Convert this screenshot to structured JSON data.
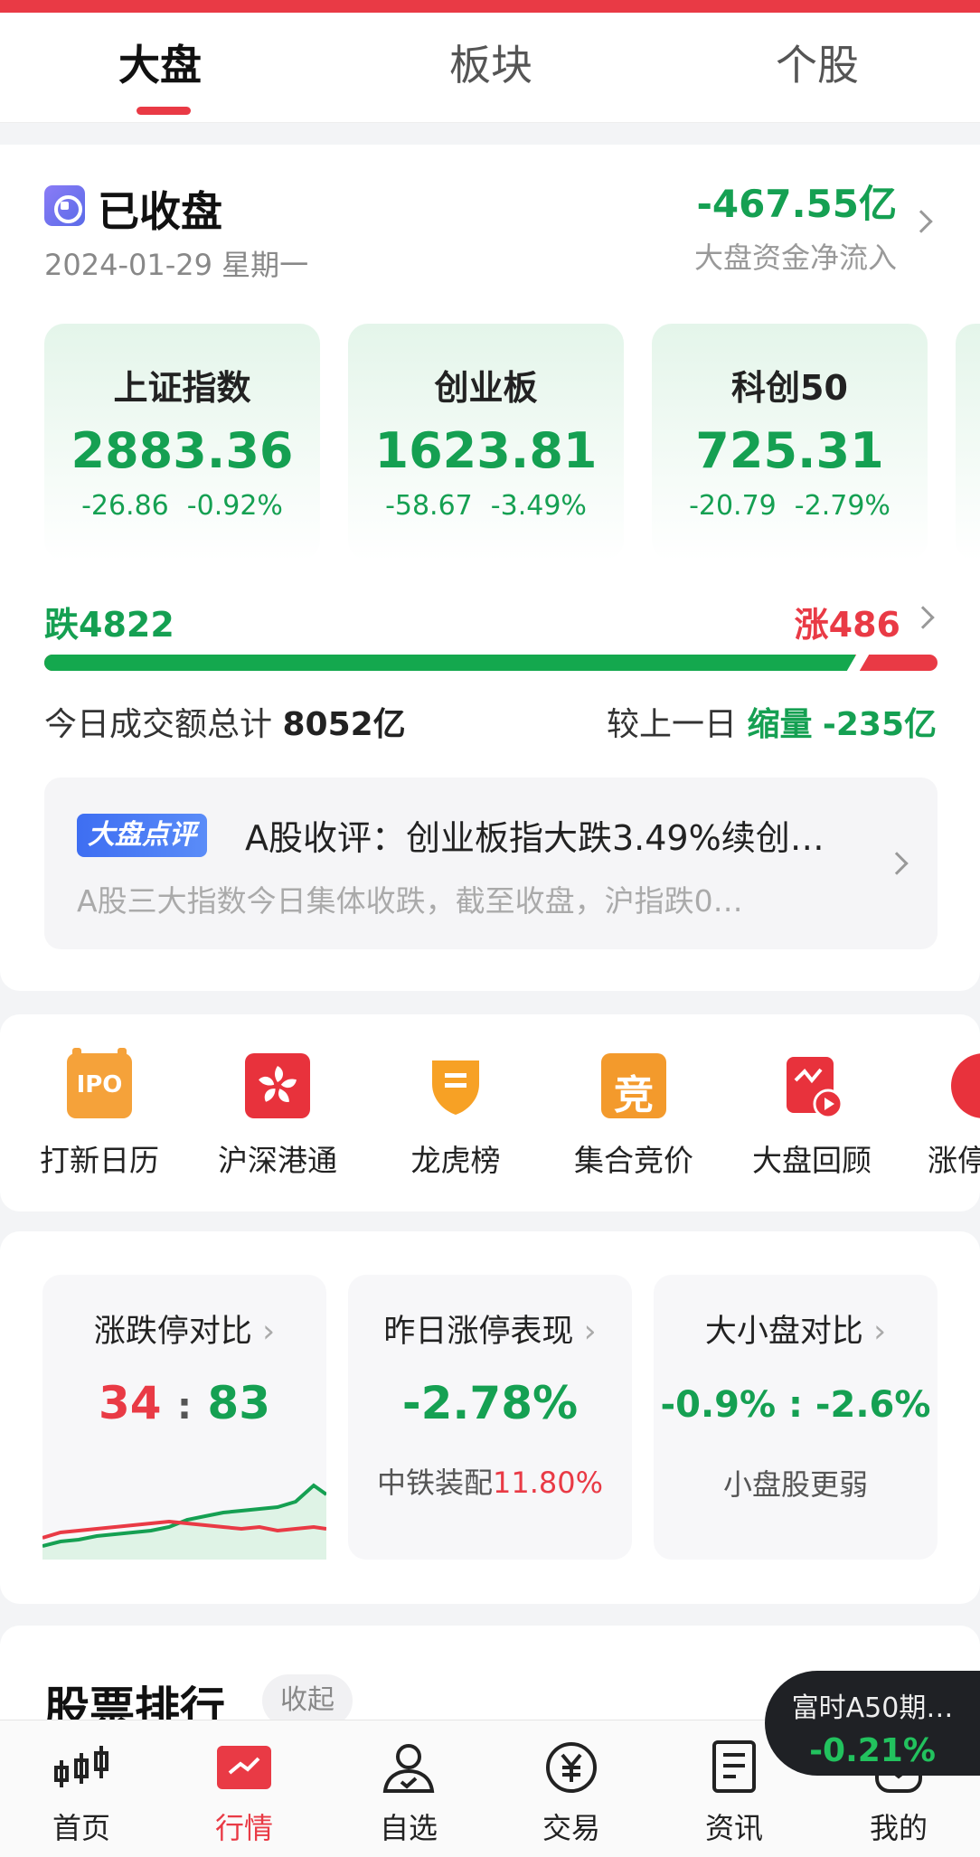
{
  "tabs": [
    {
      "label": "大盘"
    },
    {
      "label": "板块"
    },
    {
      "label": "个股"
    }
  ],
  "market": {
    "status": "已收盘",
    "date": "2024-01-29 星期一",
    "net_flow_value": "-467.55亿",
    "net_flow_label": "大盘资金净流入"
  },
  "indices": [
    {
      "name": "上证指数",
      "value": "2883.36",
      "change": "-26.86",
      "pct": "-0.92%"
    },
    {
      "name": "创业板",
      "value": "1623.81",
      "change": "-58.67",
      "pct": "-3.49%"
    },
    {
      "name": "科创50",
      "value": "725.31",
      "change": "-20.79",
      "pct": "-2.79%"
    }
  ],
  "breadth": {
    "fall_label": "跌4822",
    "rise_label": "涨486",
    "fall_fraction": 0.908
  },
  "turnover": {
    "label": "今日成交额总计",
    "value": "8052亿",
    "compare_label": "较上一日",
    "compare_state": "缩量",
    "compare_value": "-235亿"
  },
  "comment": {
    "badge": "大盘点评",
    "title": "A股收评：创业板指大跌3.49%续创…",
    "subtitle": "A股三大指数今日集体收跌，截至收盘，沪指跌0…"
  },
  "shortcuts": [
    {
      "label": "打新日历",
      "icon_text": "IPO"
    },
    {
      "label": "沪深港通"
    },
    {
      "label": "龙虎榜"
    },
    {
      "label": "集合竞价",
      "icon_text": "竞"
    },
    {
      "label": "大盘回顾"
    },
    {
      "label": "涨停"
    }
  ],
  "stats": {
    "limit_compare": {
      "title": "涨跌停对比",
      "up": "34",
      "sep": ":",
      "down": "83"
    },
    "yesterday_limit": {
      "title": "昨日涨停表现",
      "value": "-2.78%",
      "stock": "中铁装配",
      "stock_pct": "11.80%"
    },
    "cap_compare": {
      "title": "大小盘对比",
      "value": "-0.9% : -2.6%",
      "note": "小盘股更弱"
    }
  },
  "ranking": {
    "title": "股票排行",
    "collapse": "收起"
  },
  "floating": {
    "name": "富时A50期…",
    "value": "-0.21%"
  },
  "nav": [
    {
      "label": "首页"
    },
    {
      "label": "行情"
    },
    {
      "label": "自选"
    },
    {
      "label": "交易"
    },
    {
      "label": "资讯"
    },
    {
      "label": "我的"
    }
  ],
  "colors": {
    "up": "#e93a45",
    "down": "#15a052",
    "accent": "#e93a45"
  }
}
